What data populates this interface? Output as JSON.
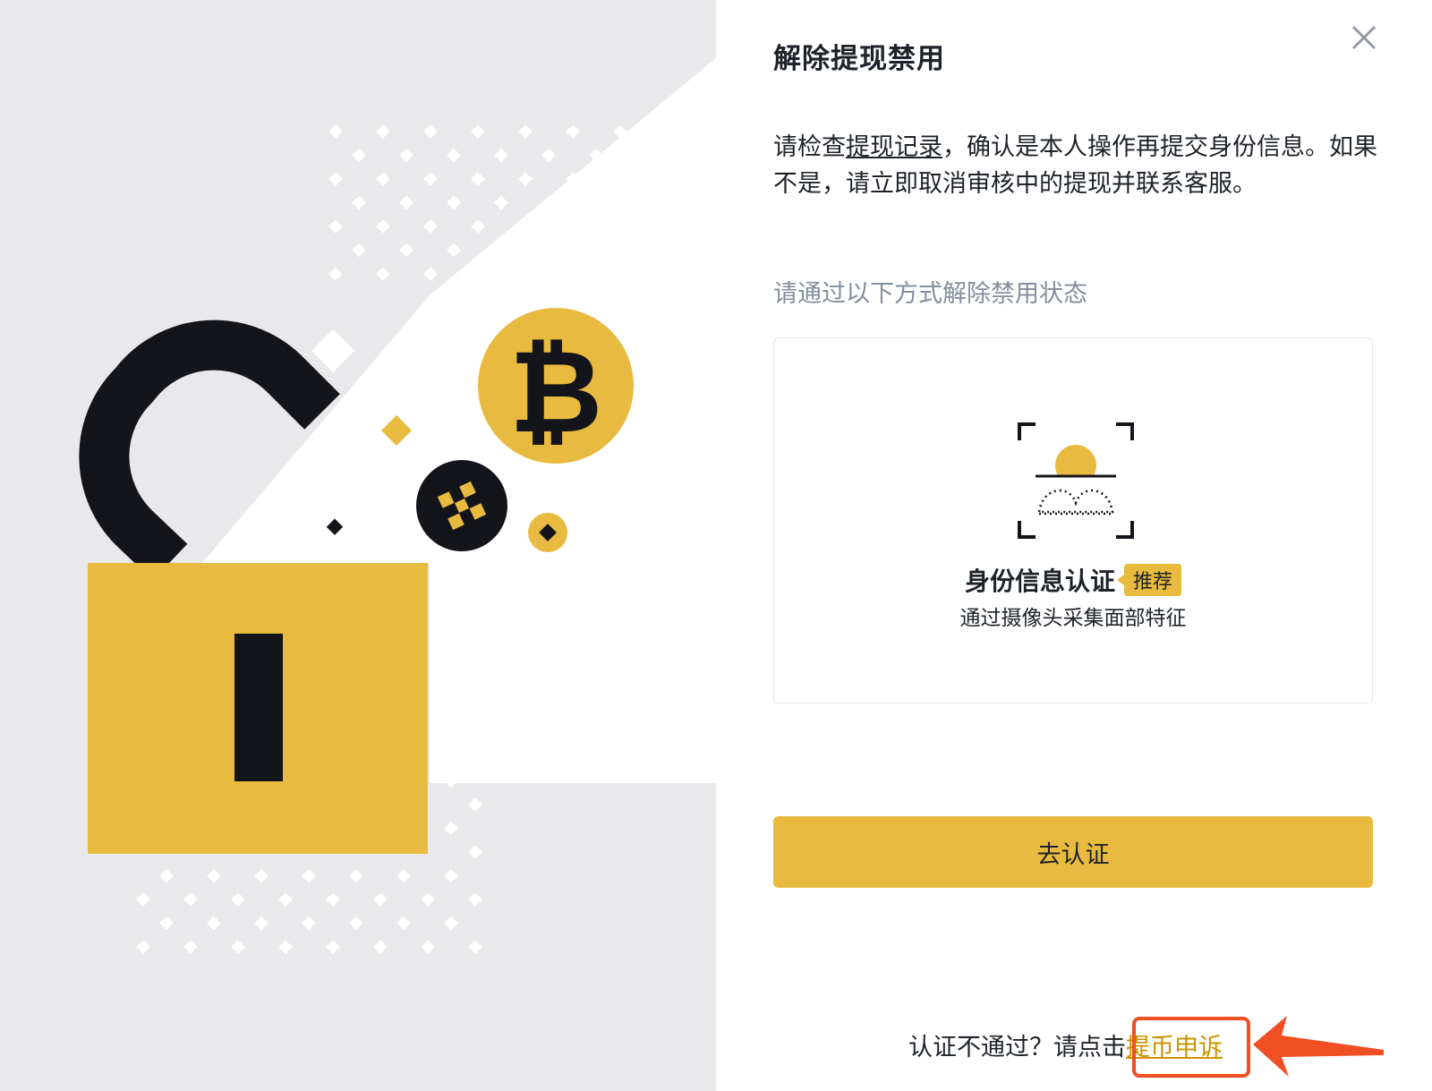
{
  "dialog": {
    "title": "解除提现禁用",
    "description_before_link": "请检查",
    "description_link": "提现记录",
    "description_after_link": "，确认是本人操作再提交身份信息。如果不是，请立即取消审核中的提现并联系客服。",
    "subheading": "请通过以下方式解除禁用状态",
    "method": {
      "title": "身份信息认证",
      "badge": "推荐",
      "subtitle": "通过摄像头采集面部特征"
    },
    "primary_button": "去认证",
    "appeal_prompt": "认证不通过？请点击",
    "appeal_link": "提币申诉"
  },
  "icons": {
    "close": "close-icon",
    "face_scan": "face-scan-icon",
    "bitcoin": "bitcoin-icon",
    "binance": "binance-icon",
    "padlock": "padlock-icon",
    "annotation_arrow": "arrow-icon"
  },
  "colors": {
    "accent": "#e8bb40",
    "link": "#c99400",
    "annotation": "#f04e23",
    "muted_text": "#848e9c"
  }
}
